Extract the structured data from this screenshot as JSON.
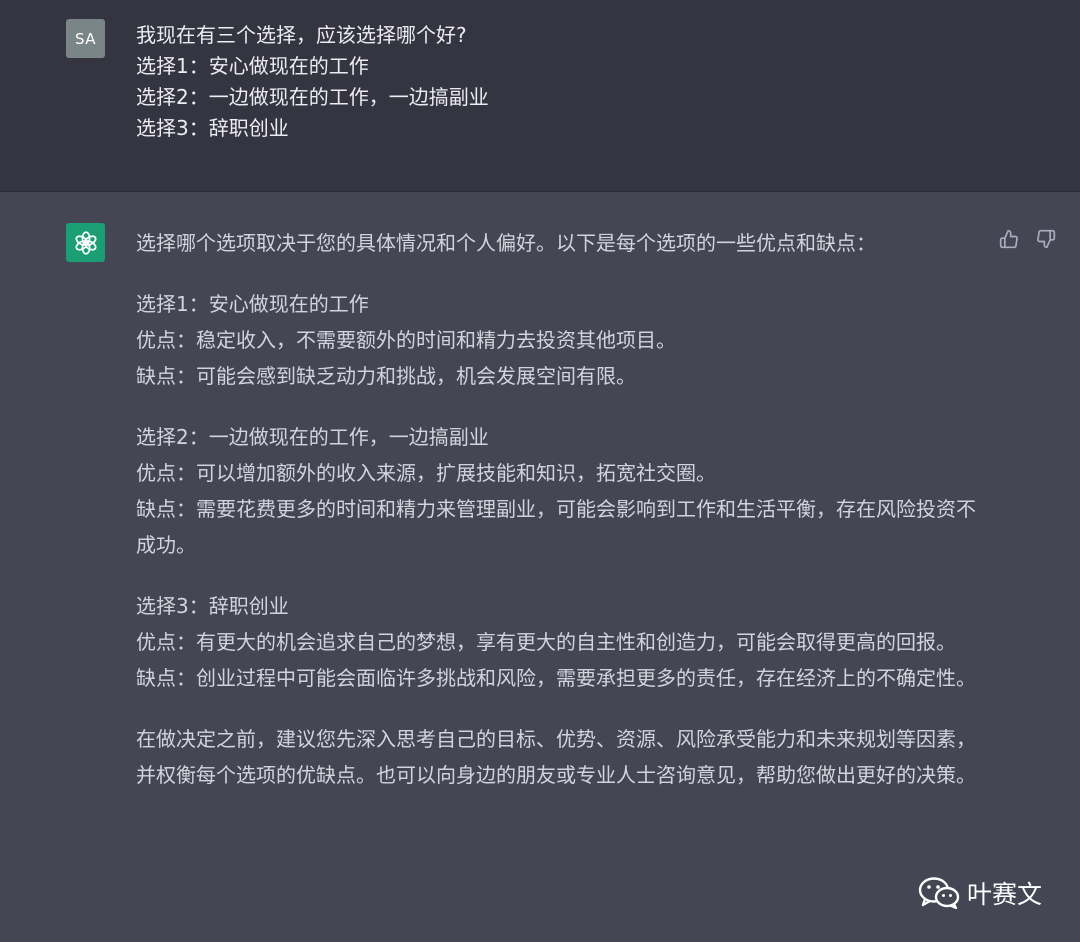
{
  "user": {
    "avatar_label": "SA",
    "lines": [
      "我现在有三个选择，应该选择哪个好?",
      "选择1：安心做现在的工作",
      "选择2：一边做现在的工作，一边搞副业",
      "选择3：辞职创业"
    ]
  },
  "assistant": {
    "intro": "选择哪个选项取决于您的具体情况和个人偏好。以下是每个选项的一些优点和缺点：",
    "options": [
      {
        "title": "选择1：安心做现在的工作",
        "pros": "优点：稳定收入，不需要额外的时间和精力去投资其他项目。",
        "cons": "缺点：可能会感到缺乏动力和挑战，机会发展空间有限。"
      },
      {
        "title": "选择2：一边做现在的工作，一边搞副业",
        "pros": "优点：可以增加额外的收入来源，扩展技能和知识，拓宽社交圈。",
        "cons": "缺点：需要花费更多的时间和精力来管理副业，可能会影响到工作和生活平衡，存在风险投资不成功。"
      },
      {
        "title": "选择3：辞职创业",
        "pros": "优点：有更大的机会追求自己的梦想，享有更大的自主性和创造力，可能会取得更高的回报。",
        "cons": "缺点：创业过程中可能会面临许多挑战和风险，需要承担更多的责任，存在经济上的不确定性。"
      }
    ],
    "conclusion": "在做决定之前，建议您先深入思考自己的目标、优势、资源、风险承受能力和未来规划等因素，并权衡每个选项的优缺点。也可以向身边的朋友或专业人士咨询意见，帮助您做出更好的决策。"
  },
  "watermark": {
    "text": "叶赛文"
  },
  "colors": {
    "user_bg": "#343541",
    "assistant_bg": "#444654",
    "assistant_avatar": "#1a9f74",
    "user_avatar": "#7a8588",
    "text": "#d1d5db"
  },
  "icons": {
    "assistant_avatar": "openai-logo-icon",
    "feedback_up": "thumbs-up-icon",
    "feedback_down": "thumbs-down-icon",
    "watermark": "wechat-icon"
  }
}
